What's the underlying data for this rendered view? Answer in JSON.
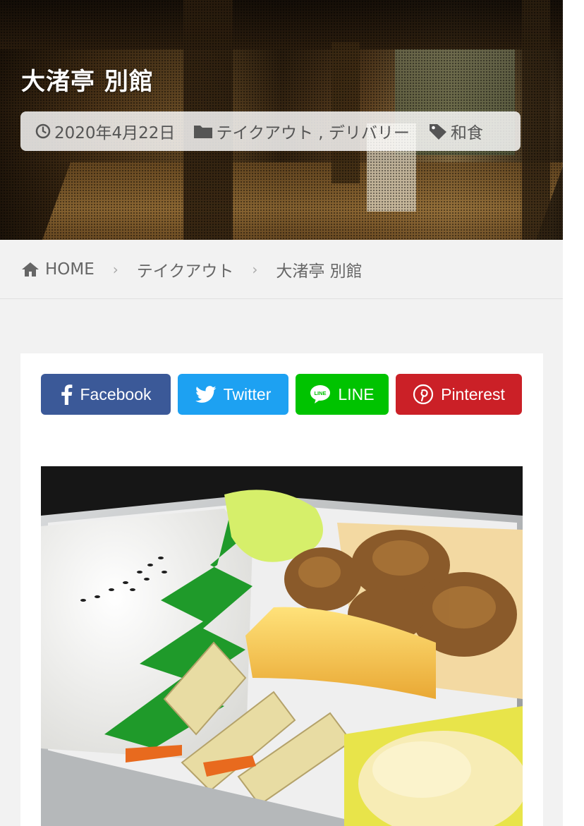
{
  "hero": {
    "title": "大渚亭 別館",
    "date": "2020年4月22日",
    "categories": "テイクアウト , デリバリー",
    "tag": "和食"
  },
  "breadcrumb": {
    "home": "HOME",
    "category": "テイクアウト",
    "current": "大渚亭 別館"
  },
  "share": {
    "facebook": "Facebook",
    "twitter": "Twitter",
    "line": "LINE",
    "pinterest": "Pinterest"
  },
  "colors": {
    "facebook": "#3b5998",
    "twitter": "#1da1f2",
    "line": "#00c300",
    "pinterest": "#cb2027",
    "page_bg": "#f2f2f2"
  },
  "icons": {
    "date": "clock-icon",
    "category": "folder-icon",
    "tag": "tag-icon",
    "home": "home-icon",
    "separator": "chevron-right-icon"
  }
}
